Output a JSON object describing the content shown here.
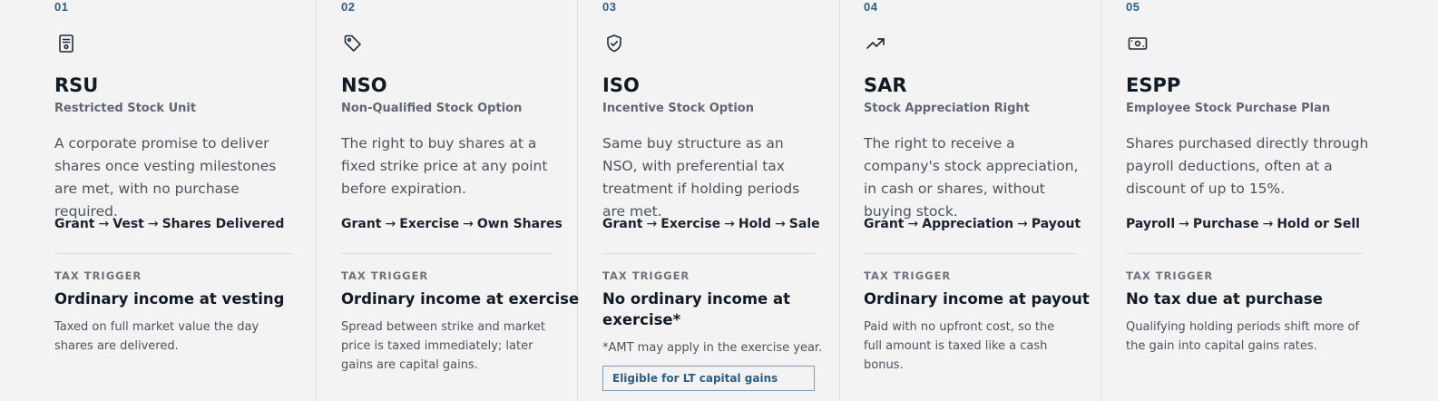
{
  "columns": [
    {
      "num": "01",
      "icon": "document-icon",
      "code": "RSU",
      "full": "Restricted Stock Unit",
      "desc": "A corporate promise to deliver shares once vesting milestones are met, with no purchase required.",
      "flow": [
        "Grant",
        "Vest",
        "Shares Delivered"
      ],
      "tax_label": "TAX TRIGGER",
      "tax_title": "Ordinary income at vesting",
      "tax_desc": "Taxed on full market value the day shares are delivered."
    },
    {
      "num": "02",
      "icon": "tag-icon",
      "code": "NSO",
      "full": "Non-Qualified Stock Option",
      "desc": "The right to buy shares at a fixed strike price at any point before expiration.",
      "flow": [
        "Grant",
        "Exercise",
        "Own Shares"
      ],
      "tax_label": "TAX TRIGGER",
      "tax_title": "Ordinary income at exercise",
      "tax_desc": "Spread between strike and market price is taxed immediately; later gains are capital gains."
    },
    {
      "num": "03",
      "icon": "shield-check-icon",
      "code": "ISO",
      "full": "Incentive Stock Option",
      "desc": "Same buy structure as an NSO, with preferential tax treatment if holding periods are met.",
      "flow": [
        "Grant",
        "Exercise",
        "Hold",
        "Sale"
      ],
      "tax_label": "TAX TRIGGER",
      "tax_title": "No ordinary income at exercise*",
      "tax_desc": "*AMT may apply in the exercise year.",
      "badge": "Eligible for LT capital gains"
    },
    {
      "num": "04",
      "icon": "trending-up-icon",
      "code": "SAR",
      "full": "Stock Appreciation Right",
      "desc": "The right to receive a company's stock appreciation, in cash or shares, without buying stock.",
      "flow": [
        "Grant",
        "Appreciation",
        "Payout"
      ],
      "tax_label": "TAX TRIGGER",
      "tax_title": "Ordinary income at payout",
      "tax_desc": "Paid with no upfront cost, so the full amount is taxed like a cash bonus."
    },
    {
      "num": "05",
      "icon": "banknote-icon",
      "code": "ESPP",
      "full": "Employee Stock Purchase Plan",
      "desc": "Shares purchased directly through payroll deductions, often at a discount of up to 15%.",
      "flow": [
        "Payroll",
        "Purchase",
        "Hold or Sell"
      ],
      "tax_label": "TAX TRIGGER",
      "tax_title": "No tax due at purchase",
      "tax_desc": "Qualifying holding periods shift more of the gain into capital gains rates."
    }
  ],
  "arrow": "→"
}
